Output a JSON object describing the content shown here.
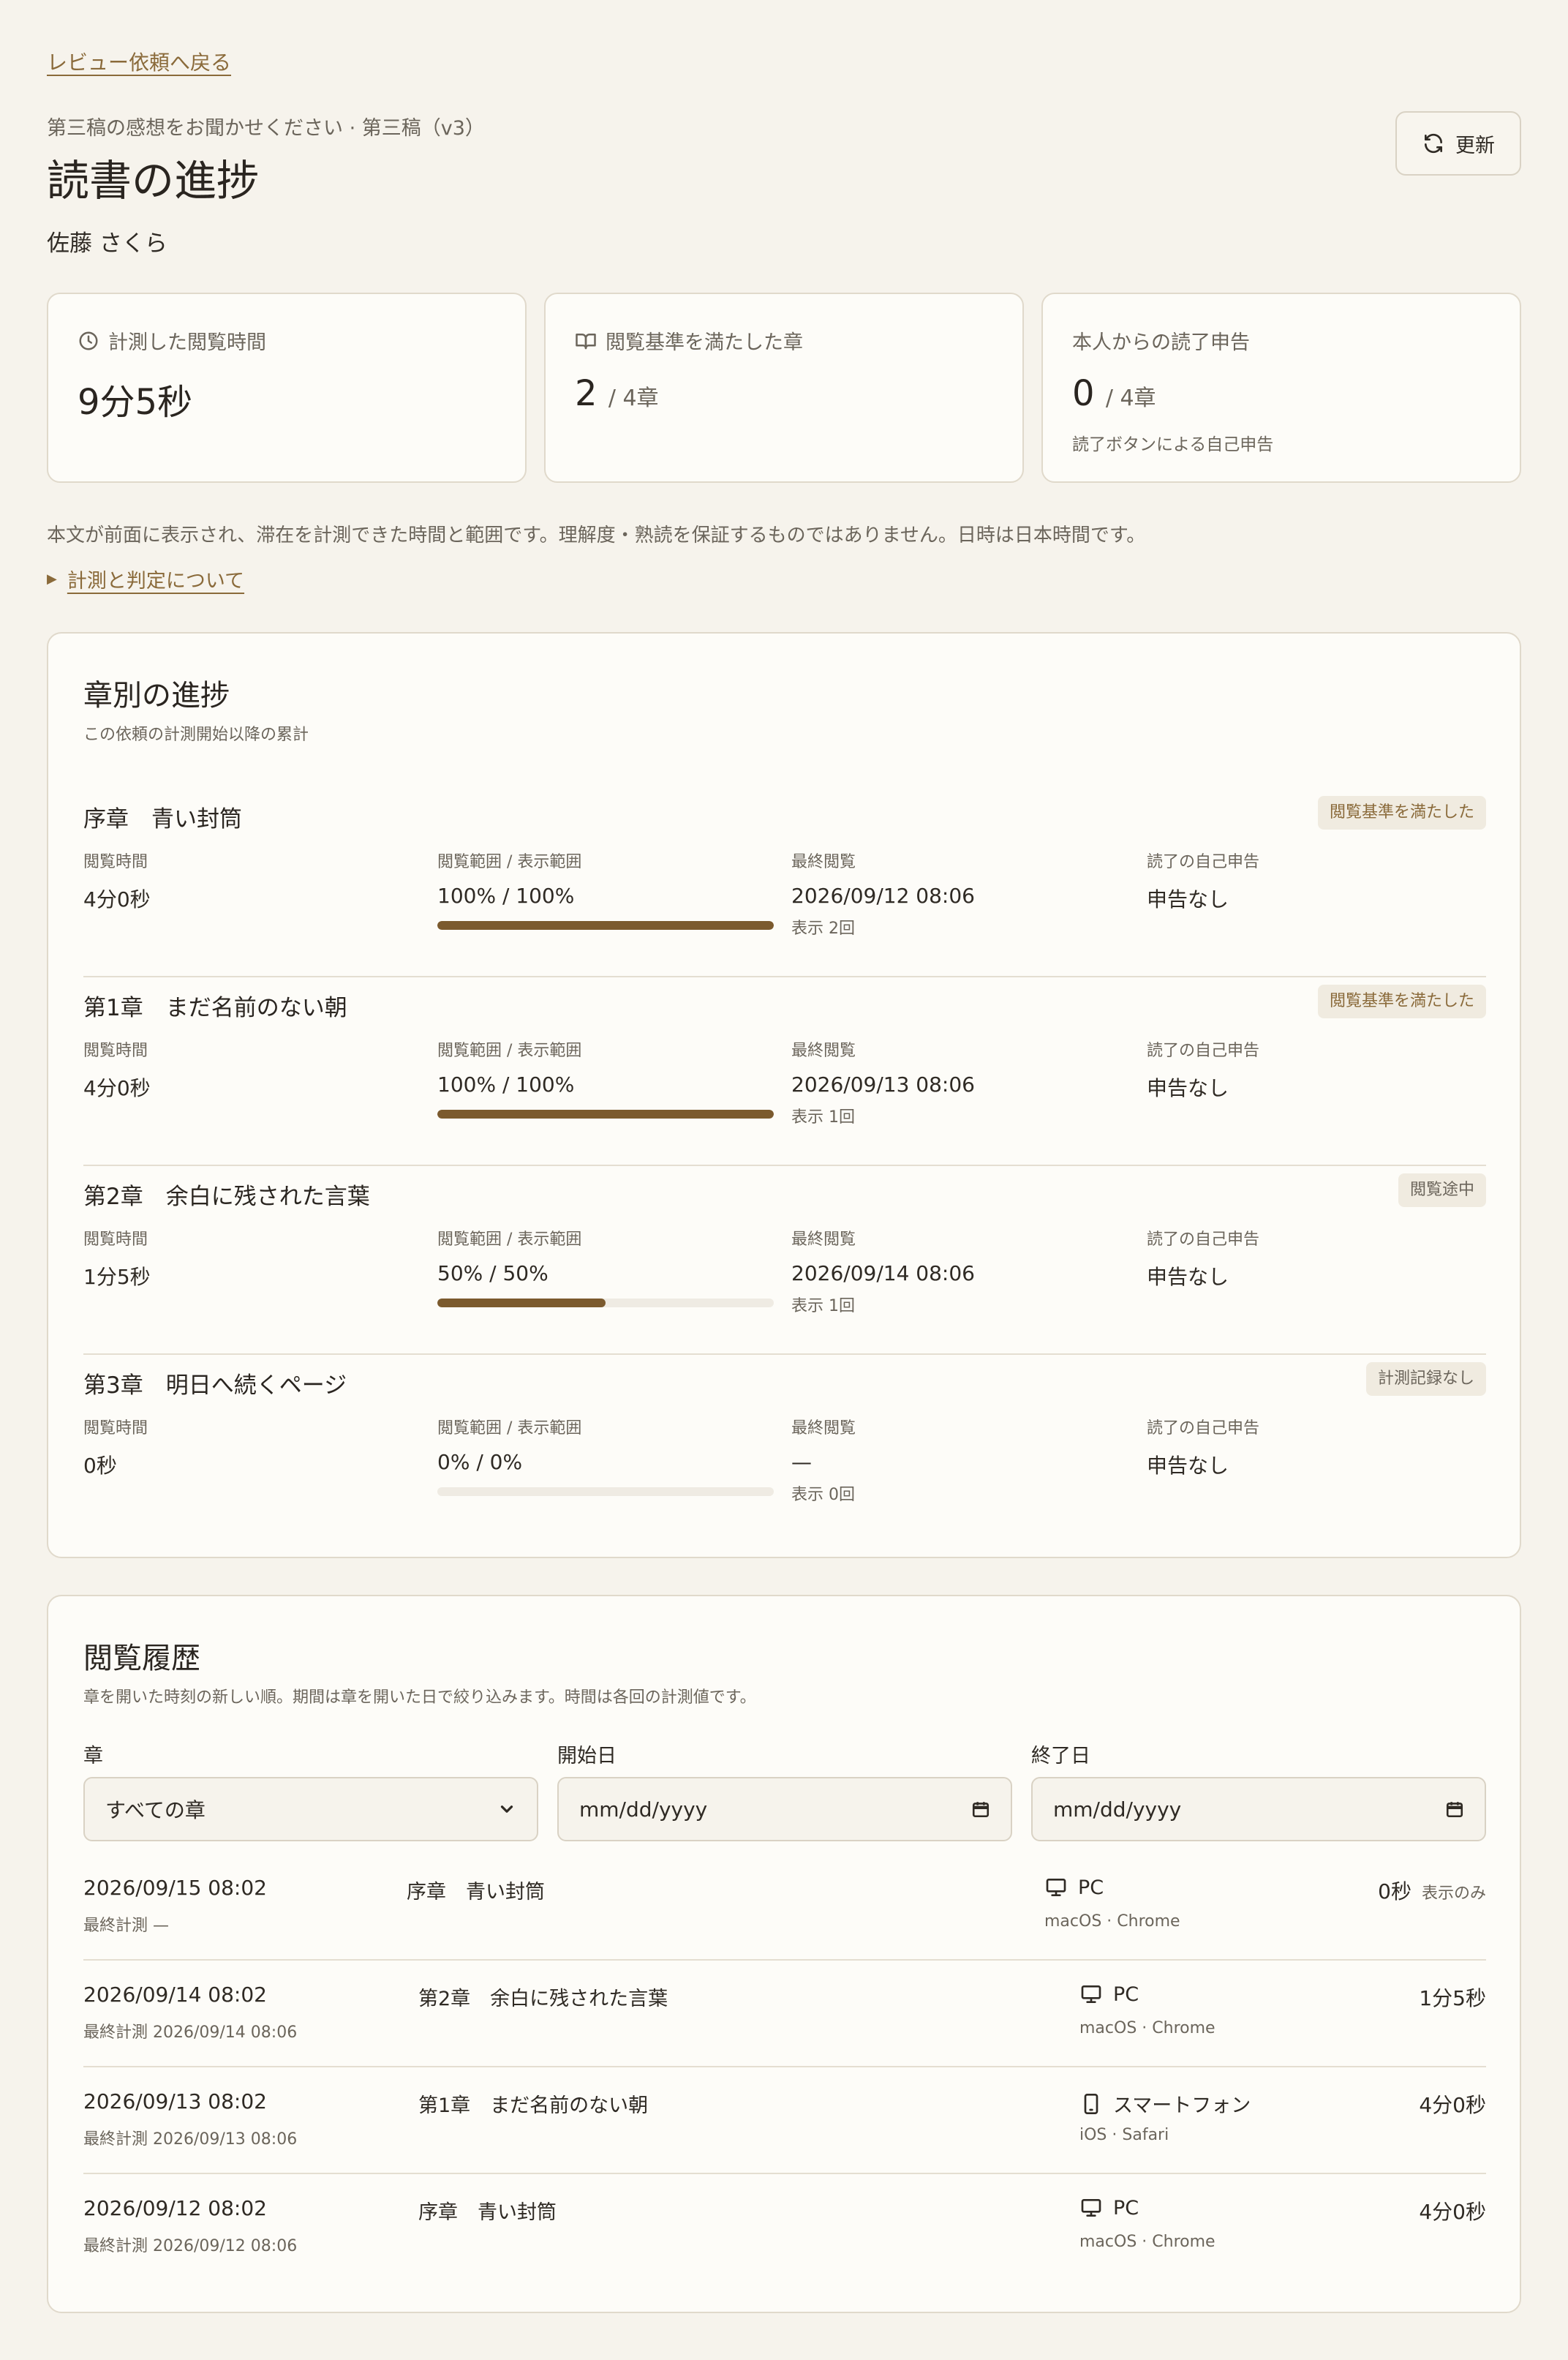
{
  "nav": {
    "back_label": "レビュー依頼へ戻る"
  },
  "header": {
    "kicker": "第三稿の感想をお聞かせください · 第三稿（v3）",
    "title": "読書の進捗",
    "reader_name": "佐藤 さくら",
    "refresh_label": "更新"
  },
  "stats": {
    "time": {
      "label": "計測した閲覧時間",
      "value": "9分5秒"
    },
    "chapters_met": {
      "label": "閲覧基準を満たした章",
      "value": "2",
      "unit": "/ 4章"
    },
    "self_reports": {
      "label": "本人からの読了申告",
      "value": "0",
      "unit": "/ 4章",
      "note": "読了ボタンによる自己申告"
    }
  },
  "disclaimer": "本文が前面に表示され、滞在を計測できた時間と範囲です。理解度・熟読を保証するものではありません。日時は日本時間です。",
  "details_toggle": "計測と判定について",
  "chapters_card": {
    "title": "章別の進捗",
    "subtitle": "この依頼の計測開始以降の累計",
    "col_labels": {
      "time": "閲覧時間",
      "range": "閲覧範囲 / 表示範囲",
      "last": "最終閲覧",
      "report": "読了の自己申告"
    },
    "chapters": [
      {
        "title": "序章　青い封筒",
        "badge": "閲覧基準を満たした",
        "time": "4分0秒",
        "range": "100% / 100%",
        "progress": 1.0,
        "last": "2026/09/12 08:06",
        "views": "表示 2回",
        "report": "申告なし"
      },
      {
        "title": "第1章　まだ名前のない朝",
        "badge": "閲覧基準を満たした",
        "time": "4分0秒",
        "range": "100% / 100%",
        "progress": 1.0,
        "last": "2026/09/13 08:06",
        "views": "表示 1回",
        "report": "申告なし"
      },
      {
        "title": "第2章　余白に残された言葉",
        "badge": "閲覧途中",
        "time": "1分5秒",
        "range": "50% / 50%",
        "progress": 0.5,
        "last": "2026/09/14 08:06",
        "views": "表示 1回",
        "report": "申告なし"
      },
      {
        "title": "第3章　明日へ続くページ",
        "badge": "計測記録なし",
        "time": "0秒",
        "range": "0% / 0%",
        "progress": 0.0,
        "last": "—",
        "views": "表示 0回",
        "report": "申告なし"
      }
    ]
  },
  "history_card": {
    "title": "閲覧履歴",
    "subtitle": "章を開いた時刻の新しい順。期間は章を開いた日で絞り込みます。時間は各回の計測値です。",
    "filters": {
      "chapter": {
        "label": "章",
        "value": "すべての章"
      },
      "start": {
        "label": "開始日",
        "value": "mm/dd/yyyy"
      },
      "end": {
        "label": "終了日",
        "value": "mm/dd/yyyy"
      }
    },
    "entries": [
      {
        "date": "2026/09/15 08:02",
        "last": "最終計測 —",
        "chapter": "序章　青い封筒",
        "device": "PC",
        "device_icon": "monitor-icon",
        "env": "macOS · Chrome",
        "duration": "0秒",
        "tag": "表示のみ"
      },
      {
        "date": "2026/09/14 08:02",
        "last": "最終計測 2026/09/14 08:06",
        "chapter": "第2章　余白に残された言葉",
        "device": "PC",
        "device_icon": "monitor-icon",
        "env": "macOS · Chrome",
        "duration": "1分5秒",
        "tag": ""
      },
      {
        "date": "2026/09/13 08:02",
        "last": "最終計測 2026/09/13 08:06",
        "chapter": "第1章　まだ名前のない朝",
        "device": "スマートフォン",
        "device_icon": "smartphone-icon",
        "env": "iOS · Safari",
        "duration": "4分0秒",
        "tag": ""
      },
      {
        "date": "2026/09/12 08:02",
        "last": "最終計測 2026/09/12 08:06",
        "chapter": "序章　青い封筒",
        "device": "PC",
        "device_icon": "monitor-icon",
        "env": "macOS · Chrome",
        "duration": "4分0秒",
        "tag": ""
      }
    ]
  },
  "colors": {
    "accent": "#8a6a3a",
    "bar_fill": "#7b5a2e",
    "background": "#f6f3ec"
  }
}
